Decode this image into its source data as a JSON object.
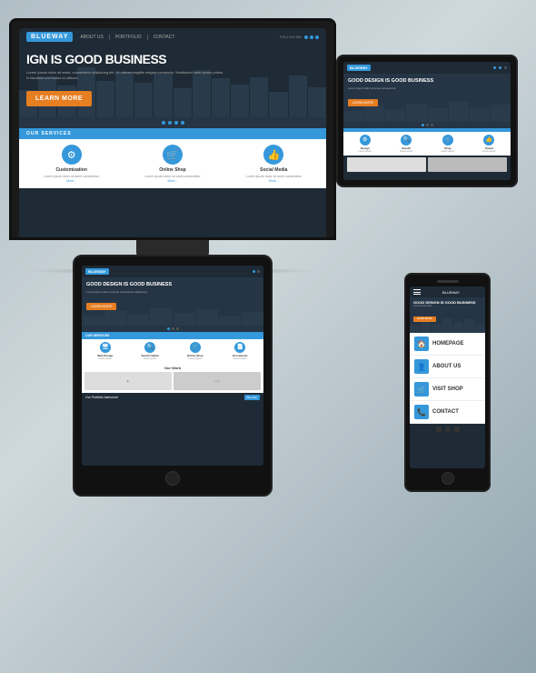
{
  "page": {
    "bg_color_start": "#b0bec5",
    "bg_color_end": "#90a4ae"
  },
  "website": {
    "brand": "BLUEWAY",
    "nav": {
      "links": [
        "ABOUT US",
        "PORTFOLIO",
        "CONTACT"
      ],
      "follow_label": "FOLLOW ME:"
    },
    "hero": {
      "title_line1": "IGN IS GOOD BUSINESS",
      "full_title": "GOOD DESIGN IS GOOD BUSINESS",
      "subtitle": "Lorem ipsum dolor sit amet, consectetur adipiscing elit. Ut ultrices sagittis magna commodo. Vestibulum ante ipsum primis in faucibus orci luctus et ultrices.",
      "cta_button": "LEARN MORE",
      "cta_color": "#e67e22"
    },
    "services": {
      "section_label": "OUR SERVICES",
      "items": [
        {
          "name": "Customization",
          "icon": "⚙",
          "desc": "Lorem ipsum dolor sit amet, consectetur adipiscing elit."
        },
        {
          "name": "Online Shop",
          "icon": "🛒",
          "desc": "Lorem ipsum dolor sit amet, consectetur adipiscing elit."
        },
        {
          "name": "Social Media",
          "icon": "👍",
          "desc": "Lorem ipsum dolor sit amet, consectetur adipiscing elit."
        }
      ]
    },
    "portfolio": {
      "label": "Our Portfolio Awesome",
      "btn_label": "Blue Btn"
    }
  },
  "phone_menu": {
    "items": [
      {
        "label": "HOMEPAGE",
        "icon": "🏠"
      },
      {
        "label": "ABOUT US",
        "icon": "👤"
      },
      {
        "label": "VISIT SHOP",
        "icon": "🛒"
      },
      {
        "label": "CONTACT",
        "icon": "📞"
      }
    ]
  },
  "accent_color": "#3498db",
  "cta_color": "#e67e22"
}
